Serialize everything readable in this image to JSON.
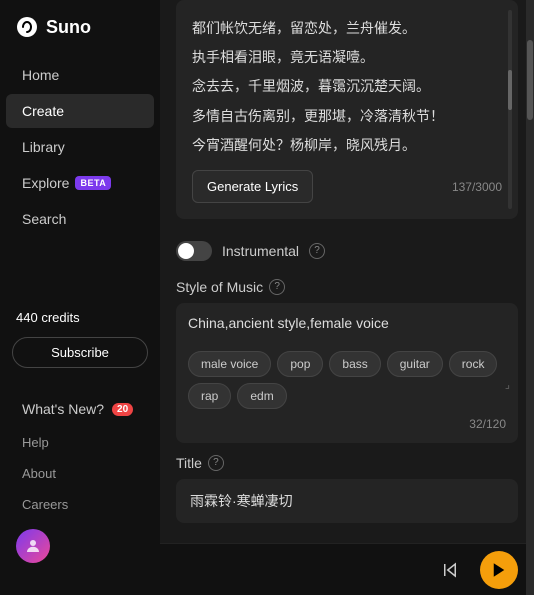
{
  "sidebar": {
    "logo": {
      "text": "Suno"
    },
    "nav_items": [
      {
        "id": "home",
        "label": "Home",
        "active": false
      },
      {
        "id": "create",
        "label": "Create",
        "active": true
      },
      {
        "id": "library",
        "label": "Library",
        "active": false
      },
      {
        "id": "explore",
        "label": "Explore",
        "active": false,
        "badge": "BETA"
      },
      {
        "id": "search",
        "label": "Search",
        "active": false
      }
    ],
    "credits": {
      "count": "440",
      "label": "credits"
    },
    "subscribe_label": "Subscribe",
    "whats_new_label": "What's New?",
    "whats_new_count": "20",
    "help_label": "Help",
    "about_label": "About",
    "careers_label": "Careers"
  },
  "lyrics": {
    "lines": [
      "都们帐饮无绪，留恋处，兰舟催发。",
      "执手相看泪眼，竟无语凝噎。",
      "念去去，千里烟波，暮霭沉沉楚天阔。",
      "多情自古伤离别，更那堪，冷落清秋节！",
      "今宵酒醒何处？杨柳岸，晓风残月。"
    ],
    "generate_btn": "Generate Lyrics",
    "counter": "137/3000"
  },
  "instrumental": {
    "label": "Instrumental",
    "help_tooltip": "?"
  },
  "style_of_music": {
    "section_label": "Style of Music",
    "help_tooltip": "?",
    "input_value": "China,ancient style,female voice",
    "tags": [
      "male voice",
      "pop",
      "bass",
      "guitar",
      "rock",
      "rap",
      "edm"
    ],
    "counter": "32/120"
  },
  "title": {
    "section_label": "Title",
    "help_tooltip": "?",
    "input_value": "雨霖铃·寒蝉凄切"
  },
  "player": {
    "skip_icon": "skip-back",
    "play_icon": "play"
  }
}
